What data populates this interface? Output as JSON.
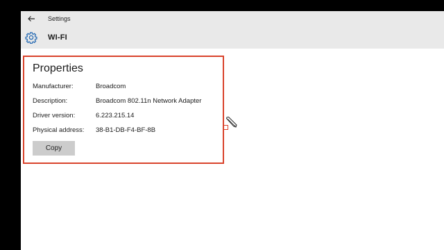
{
  "window": {
    "title": "Settings"
  },
  "header": {
    "page_title": "WI-FI"
  },
  "properties": {
    "heading": "Properties",
    "rows": [
      {
        "label": "Manufacturer:",
        "value": "Broadcom"
      },
      {
        "label": "Description:",
        "value": "Broadcom 802.11n Network Adapter"
      },
      {
        "label": "Driver version:",
        "value": "6.223.215.14"
      },
      {
        "label": "Physical address:",
        "value": "38-B1-DB-F4-BF-8B"
      }
    ],
    "copy_label": "Copy"
  },
  "colors": {
    "highlight_border": "#d9422b",
    "gear_icon": "#2d6fb5",
    "header_bg": "#e9e9e9",
    "button_bg": "#cccccc"
  },
  "icons": {
    "back": "back-arrow-icon",
    "settings": "gear-icon",
    "cursor": "pencil-cursor-icon"
  }
}
